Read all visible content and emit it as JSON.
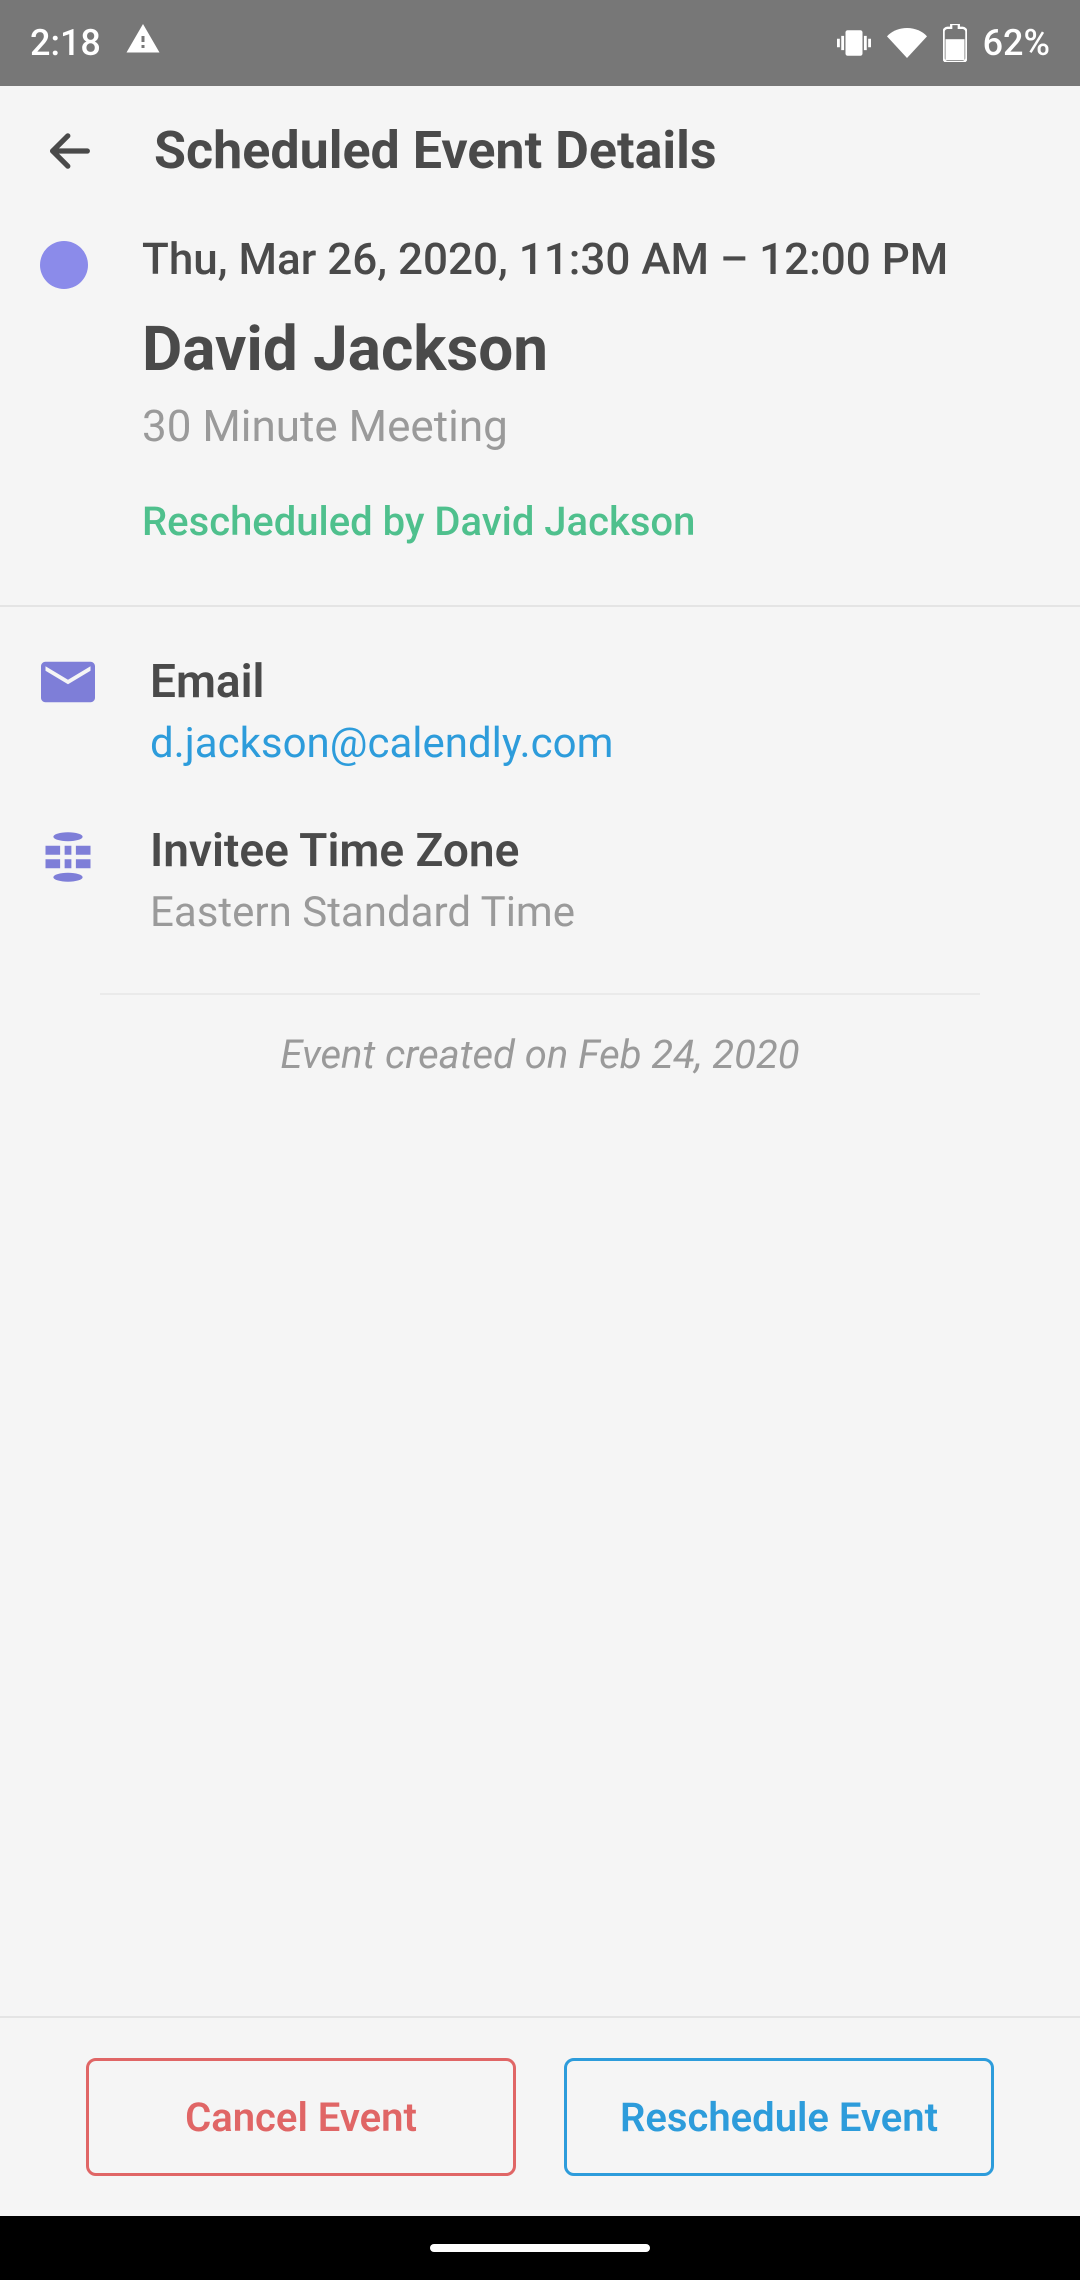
{
  "status_bar": {
    "time": "2:18",
    "battery": "62%"
  },
  "header": {
    "title": "Scheduled Event Details"
  },
  "event": {
    "datetime": "Thu, Mar 26, 2020, 11:30 AM – 12:00 PM",
    "invitee_name": "David Jackson",
    "event_type": "30 Minute Meeting",
    "status_note": "Rescheduled by David Jackson",
    "color": "#8b8bea"
  },
  "details": {
    "email": {
      "label": "Email",
      "value": "d.jackson@calendly.com"
    },
    "timezone": {
      "label": "Invitee Time Zone",
      "value": "Eastern Standard Time"
    }
  },
  "meta": {
    "created_on": "Event created on Feb 24, 2020"
  },
  "actions": {
    "cancel": "Cancel Event",
    "reschedule": "Reschedule Event"
  }
}
